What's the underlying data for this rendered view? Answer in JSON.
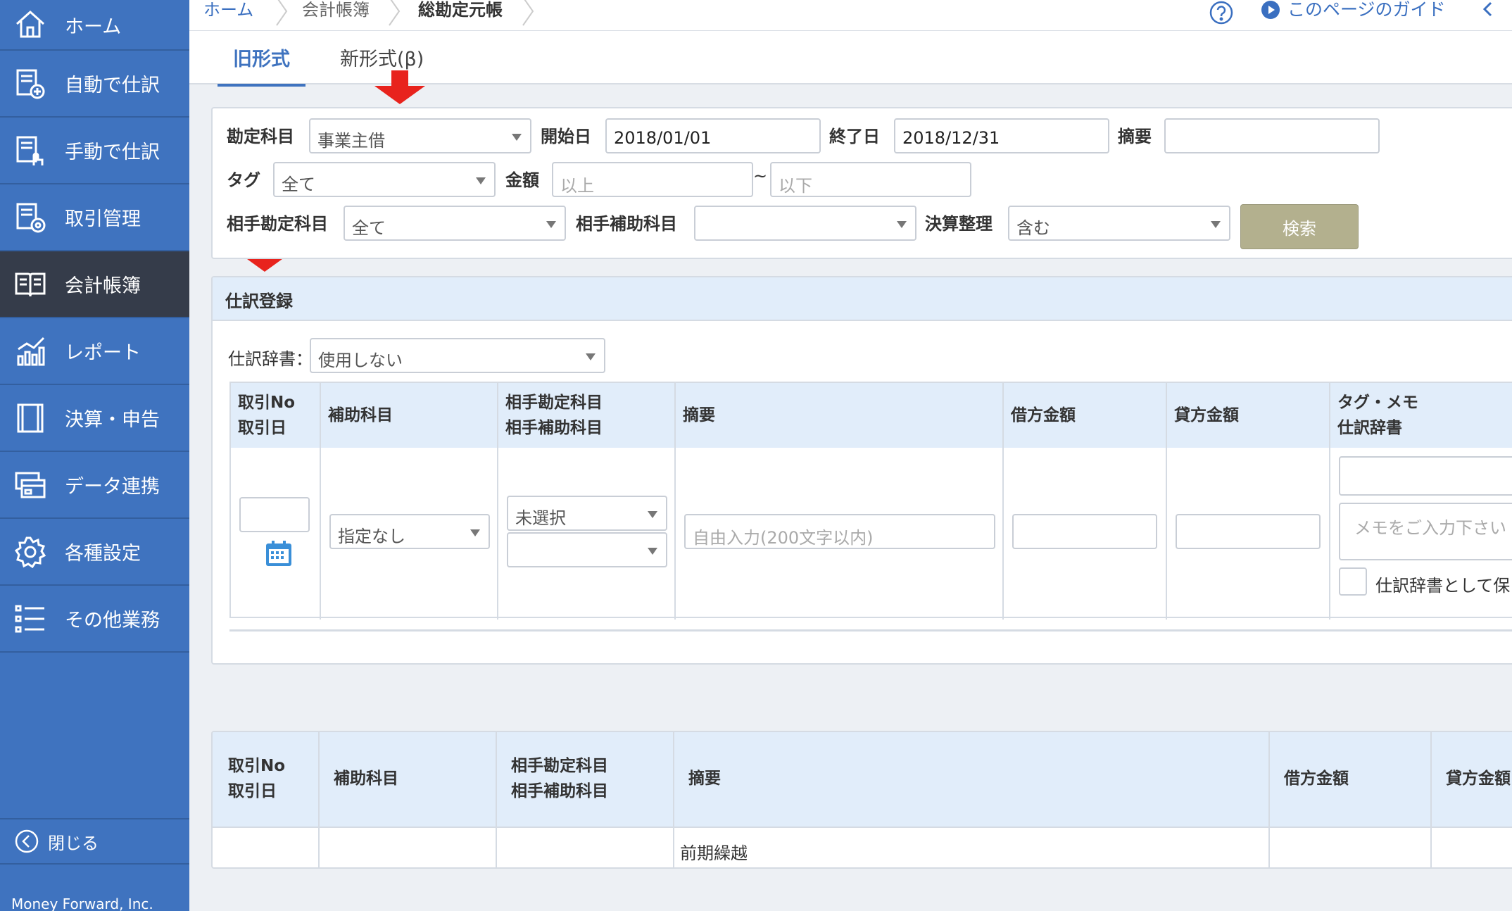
{
  "sidebar": {
    "items": [
      {
        "label": "ホーム",
        "icon": "home-icon"
      },
      {
        "label": "自動で仕訳",
        "icon": "auto-journal-icon"
      },
      {
        "label": "手動で仕訳",
        "icon": "manual-journal-icon"
      },
      {
        "label": "取引管理",
        "icon": "transaction-icon"
      },
      {
        "label": "会計帳簿",
        "icon": "ledger-book-icon"
      },
      {
        "label": "レポート",
        "icon": "report-chart-icon"
      },
      {
        "label": "決算・申告",
        "icon": "settlement-icon"
      },
      {
        "label": "データ連携",
        "icon": "data-link-icon"
      },
      {
        "label": "各種設定",
        "icon": "gear-icon"
      },
      {
        "label": "その他業務",
        "icon": "list-icon"
      }
    ],
    "close_label": "閉じる",
    "footer": "Money Forward, Inc."
  },
  "header": {
    "breadcrumb": [
      "ホーム",
      "会計帳簿",
      "総勘定元帳"
    ],
    "guide_label": "このページのガイド"
  },
  "tabs": [
    "旧形式",
    "新形式(β)"
  ],
  "filters": {
    "account_label": "勘定科目",
    "account_value": "事業主借",
    "start_label": "開始日",
    "start_value": "2018/01/01",
    "end_label": "終了日",
    "end_value": "2018/12/31",
    "memo_label": "摘要",
    "tag_label": "タグ",
    "tag_value": "全て",
    "amount_label": "金額",
    "amount_min_placeholder": "以上",
    "amount_sep": "~",
    "amount_max_placeholder": "以下",
    "counter_account_label": "相手勘定科目",
    "counter_account_value": "全て",
    "counter_sub_label": "相手補助科目",
    "settlement_label": "決算整理",
    "settlement_value": "含む",
    "search_label": "検索"
  },
  "entry": {
    "title": "仕訳登録",
    "dict_label": "仕訳辞書：",
    "dict_value": "使用しない",
    "columns": {
      "no_line1": "取引No",
      "no_line2": "取引日",
      "sub": "補助科目",
      "counter_line1": "相手勘定科目",
      "counter_line2": "相手補助科目",
      "memo": "摘要",
      "debit": "借方金額",
      "credit": "貸方金額",
      "tag_line1": "タグ・メモ",
      "tag_line2": "仕訳辞書"
    },
    "sub_value": "指定なし",
    "counter_value": "未選択",
    "memo_placeholder": "自由入力(200文字以内)",
    "memo_note_placeholder": "メモをご入力下さい",
    "save_dict_label": "仕訳辞書として保"
  },
  "ledger": {
    "columns": {
      "no_line1": "取引No",
      "no_line2": "取引日",
      "sub": "補助科目",
      "counter_line1": "相手勘定科目",
      "counter_line2": "相手補助科目",
      "memo": "摘要",
      "debit": "借方金額",
      "credit": "貸方金額"
    },
    "rows": [
      {
        "memo": "前期繰越"
      }
    ]
  },
  "colors": {
    "sidebar": "#3f73bf",
    "sidebar_active": "#353c4a",
    "accent": "#3f73bf",
    "header_row": "#e1edfa",
    "search_button": "#b3b08e",
    "annotation_arrow": "#e8231d"
  }
}
